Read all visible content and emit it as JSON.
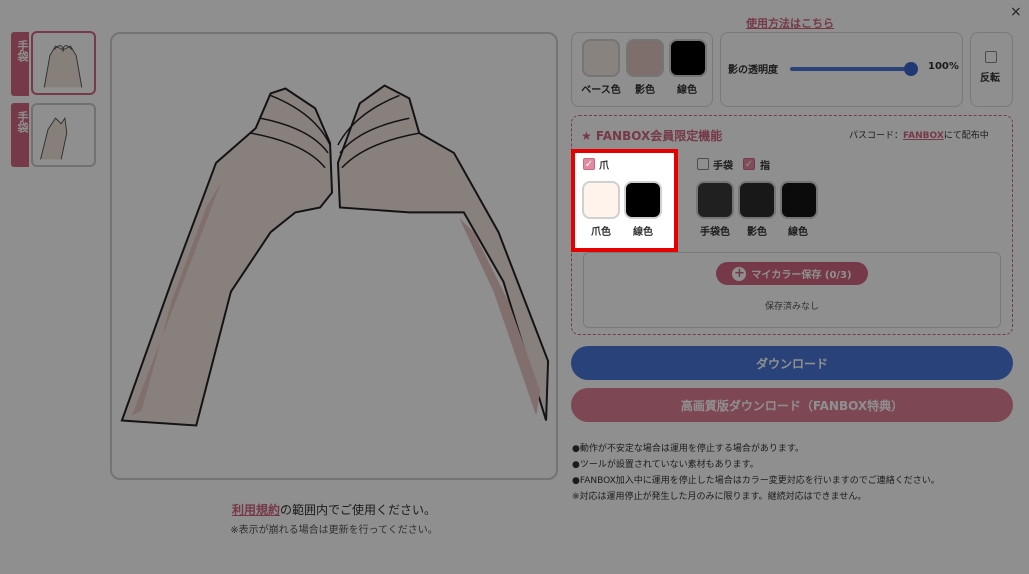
{
  "window": {
    "close_glyph": "×"
  },
  "thumbnails": [
    {
      "tag": "手袋",
      "active": true
    },
    {
      "tag": "手袋",
      "active": false
    }
  ],
  "canvas": {
    "description_icon": "heart-hands-illustration"
  },
  "terms": {
    "link_text": "利用規約",
    "text": "の範囲内でご使用ください。",
    "note": "※表示が崩れる場合は更新を行ってください。"
  },
  "usage_link": "使用方法はこちら",
  "colors_panel": {
    "swatches": [
      {
        "label": "ベース色",
        "color": "#f4e9e2"
      },
      {
        "label": "影色",
        "color": "#e3c6c0"
      },
      {
        "label": "線色",
        "color": "#000000"
      }
    ]
  },
  "shadow": {
    "label": "影の透明度",
    "value": "100%",
    "level": 1.0
  },
  "flip": {
    "label": "反転"
  },
  "fanbox": {
    "title": "★ FANBOX会員限定機能",
    "passcode_prefix": "パスコード：",
    "passcode_link": "FANBOX",
    "passcode_suffix": "にて配布中",
    "nail": {
      "checkbox_label": "爪",
      "checked": true,
      "swatches": [
        {
          "label": "爪色",
          "color": "#fff3ec"
        },
        {
          "label": "線色",
          "color": "#000000"
        }
      ]
    },
    "glove": {
      "checkbox_label": "手袋",
      "checked": false
    },
    "finger": {
      "checkbox_label": "指",
      "checked": true
    },
    "glove_swatches": [
      {
        "label": "手袋色",
        "color": "#3a3a3a"
      },
      {
        "label": "影色",
        "color": "#2b2b2b"
      },
      {
        "label": "線色",
        "color": "#141414"
      }
    ],
    "mycolor_button": "マイカラー保存 (0/3)",
    "saved_none": "保存済みなし"
  },
  "buttons": {
    "download": "ダウンロード",
    "hq_download": "高画質版ダウンロード（FANBOX特典）"
  },
  "notes": [
    "●動作が不安定な場合は運用を停止する場合があります。",
    "●ツールが設置されていない素材もあります。",
    "●FANBOX加入中に運用を停止した場合はカラー変更対応を行いますのでご連絡ください。",
    "※対応は運用停止が発生した月のみに限ります。継続対応はできません。"
  ],
  "accent_colors": {
    "pink": "#d2677f",
    "blue": "#4a78d9",
    "highlight": "#e60000"
  }
}
